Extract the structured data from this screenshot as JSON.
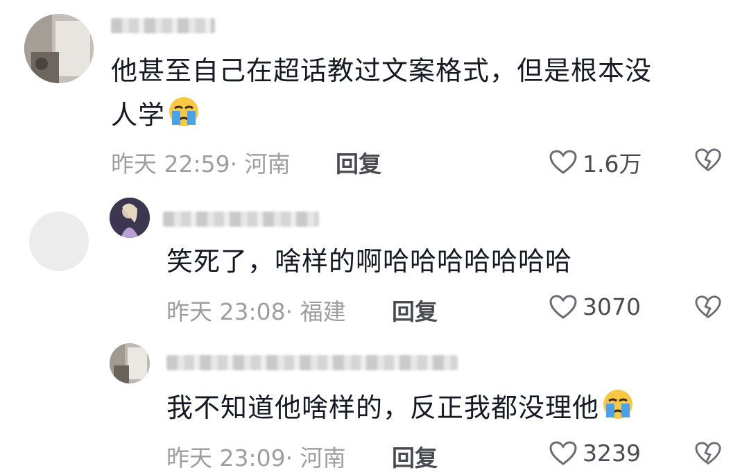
{
  "comments": [
    {
      "text_line1": "他甚至自己在超话教过文案格式，但是根本没",
      "text_line2": "人学",
      "emoji": "crying-face-icon",
      "time": "昨天 22:59·",
      "location": "河南",
      "reply_label": "回复",
      "likes": "1.6万"
    },
    {
      "text": "笑死了，啥样的啊哈哈哈哈哈哈哈",
      "time": "昨天 23:08·",
      "location": "福建",
      "reply_label": "回复",
      "likes": "3070"
    },
    {
      "text": "我不知道他啥样的，反正我都没理他",
      "emoji": "crying-face-icon",
      "time": "昨天 23:09·",
      "location": "河南",
      "reply_label": "回复",
      "likes": "3239"
    }
  ],
  "colors": {
    "text": "#161823",
    "meta": "#9d9da2",
    "action": "#4a4a52",
    "emoji_face": "#f7c843",
    "emoji_tear": "#4aa3e8"
  }
}
